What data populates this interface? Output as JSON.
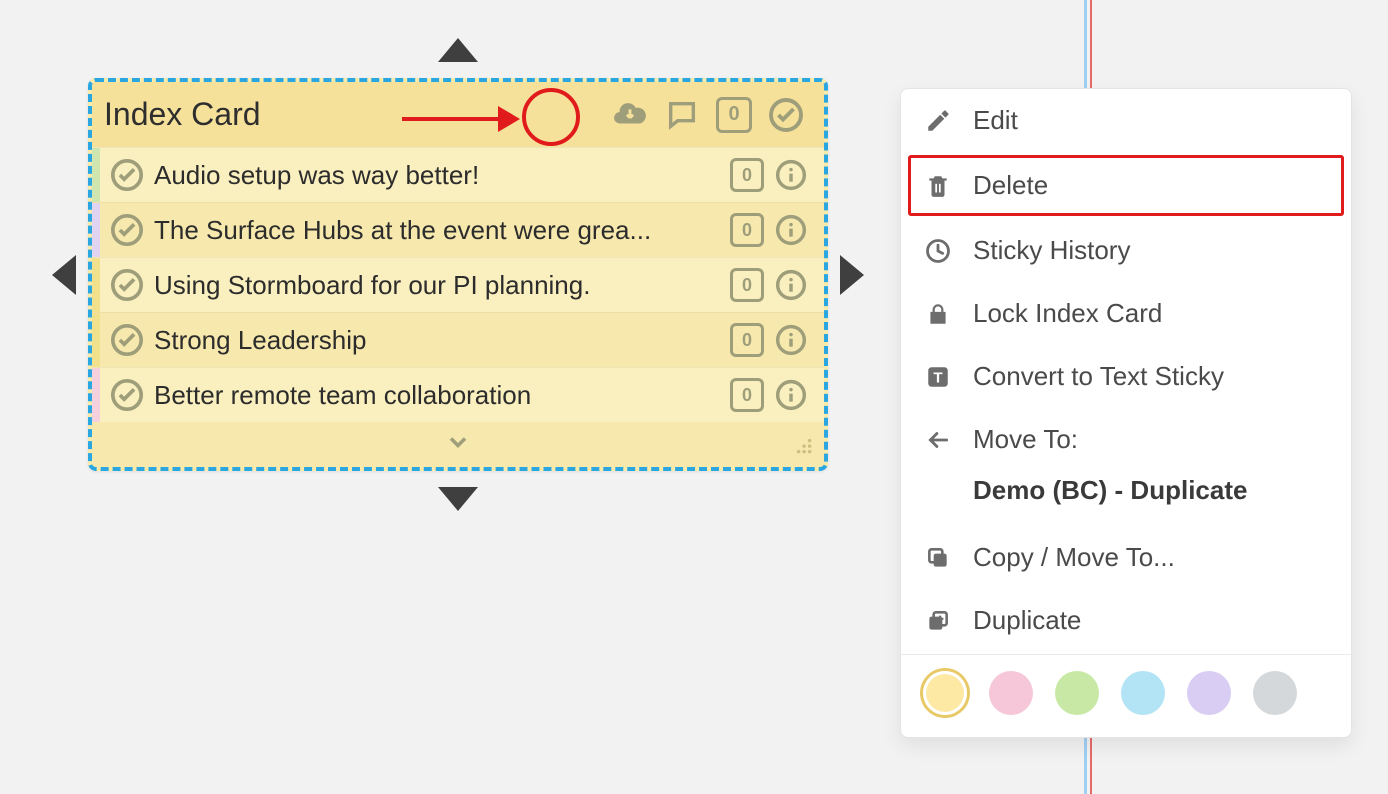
{
  "card": {
    "title": "Index Card",
    "header_badge": "0",
    "rows": [
      {
        "stripe": "green",
        "text": "Audio setup was way better!",
        "count": "0"
      },
      {
        "stripe": "purple",
        "text": "The Surface Hubs at the event were grea...",
        "count": "0"
      },
      {
        "stripe": "yellow",
        "text": "Using Stormboard for our PI planning.",
        "count": "0"
      },
      {
        "stripe": "yellow",
        "text": "Strong Leadership",
        "count": "0"
      },
      {
        "stripe": "pink",
        "text": "Better remote team collaboration",
        "count": "0"
      }
    ]
  },
  "menu": {
    "edit": "Edit",
    "delete": "Delete",
    "history": "Sticky History",
    "lock": "Lock Index Card",
    "convert": "Convert to Text Sticky",
    "move_label": "Move To:",
    "move_target": "Demo (BC) - Duplicate",
    "copy_move": "Copy / Move To...",
    "duplicate": "Duplicate"
  },
  "swatches": {
    "yellow": "#fde9a4",
    "pink": "#f6c7d9",
    "green": "#c8e9a5",
    "blue": "#b3e4f6",
    "purple": "#d9cdf3",
    "gray": "#d5d8da"
  }
}
